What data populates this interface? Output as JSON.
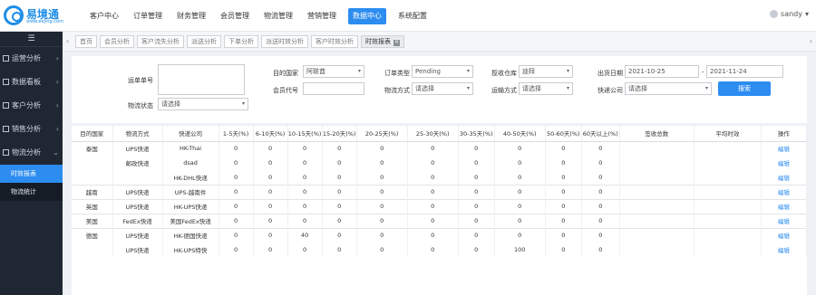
{
  "brand": {
    "name": "易境通",
    "url": "www.eejing.com"
  },
  "nav": [
    "客户中心",
    "订单管理",
    "财务管理",
    "会员管理",
    "物流管理",
    "营销管理",
    "数据中心",
    "系统配置"
  ],
  "nav_active_index": 6,
  "user": {
    "name": "sandy"
  },
  "sidebar": {
    "toggle_icon": "menu-icon",
    "items": [
      {
        "label": "运营分析"
      },
      {
        "label": "数据看板"
      },
      {
        "label": "客户分析"
      },
      {
        "label": "销售分析"
      },
      {
        "label": "物流分析"
      }
    ],
    "subitems": [
      "时效报表",
      "物流统计"
    ],
    "active_sub_index": 0
  },
  "tabs": [
    "首页",
    "会员分析",
    "客户流失分析",
    "派送分析",
    "下单分析",
    "派送时效分析",
    "客户时效分析",
    "时效报表"
  ],
  "active_tab_index": 7,
  "filters": {
    "order_no_label": "运单单号",
    "destination_label": "目的国家",
    "destination_value": "阿联酋",
    "warehouse_label": "揽收仓库",
    "warehouse_value": "迪拜",
    "time_type_label": "订单类型",
    "time_type_value": "Pending",
    "customer_no_label": "会员代号",
    "customer_no_value": "",
    "service_label": "物流方式",
    "service_value": "请选择",
    "shipping_type_label": "运输方式",
    "shipping_type_value": "请选择",
    "pickup_label": "物流状态",
    "pickup_value": "请选择",
    "date_label": "出货日期",
    "date_from": "2021-10-25",
    "date_to": "2021-11-24",
    "company_label": "快递公司",
    "company_value": "请选择",
    "search_label": "搜索"
  },
  "table": {
    "headers": [
      "目的国家",
      "物流方式",
      "快递公司",
      "1-5天(%)",
      "6-10天(%)",
      "10-15天(%)",
      "15-20天(%)",
      "20-25天(%)",
      "25-30天(%)",
      "30-35天(%)",
      "40-50天(%)",
      "50-60天(%)",
      "60天以上(%)",
      "签收总数",
      "平均时效",
      "操作"
    ],
    "rows": [
      [
        "泰国",
        "UPS快递",
        "HK-Thai",
        "0",
        "0",
        "0",
        "0",
        "0",
        "0",
        "0",
        "0",
        "0",
        "0",
        "",
        "",
        "编辑"
      ],
      [
        "",
        "邮政快递",
        "dsad",
        "0",
        "0",
        "0",
        "0",
        "0",
        "0",
        "0",
        "0",
        "0",
        "0",
        "",
        "",
        "编辑"
      ],
      [
        "",
        "",
        "HK-DHL快递",
        "0",
        "0",
        "0",
        "0",
        "0",
        "0",
        "0",
        "0",
        "0",
        "0",
        "",
        "",
        "编辑"
      ],
      [
        "越南",
        "UPS快递",
        "UPS-越南件",
        "0",
        "0",
        "0",
        "0",
        "0",
        "0",
        "0",
        "0",
        "0",
        "0",
        "",
        "",
        "编辑"
      ],
      [
        "英国",
        "UPS快递",
        "HK-UPS快递",
        "0",
        "0",
        "0",
        "0",
        "0",
        "0",
        "0",
        "0",
        "0",
        "0",
        "",
        "",
        "编辑"
      ],
      [
        "美国",
        "FedEx快递",
        "美国FedEx快递",
        "0",
        "0",
        "0",
        "0",
        "0",
        "0",
        "0",
        "0",
        "0",
        "0",
        "",
        "",
        "编辑"
      ],
      [
        "德国",
        "UPS快递",
        "HK-德国快递",
        "0",
        "0",
        "40",
        "0",
        "0",
        "0",
        "0",
        "0",
        "0",
        "0",
        "",
        "",
        "编辑"
      ],
      [
        "",
        "UPS快递",
        "HK-UPS特快",
        "0",
        "0",
        "0",
        "0",
        "0",
        "0",
        "0",
        "100",
        "0",
        "0",
        "",
        "",
        "编辑"
      ]
    ],
    "separator_rows": [
      0,
      3,
      4,
      5,
      6
    ]
  }
}
